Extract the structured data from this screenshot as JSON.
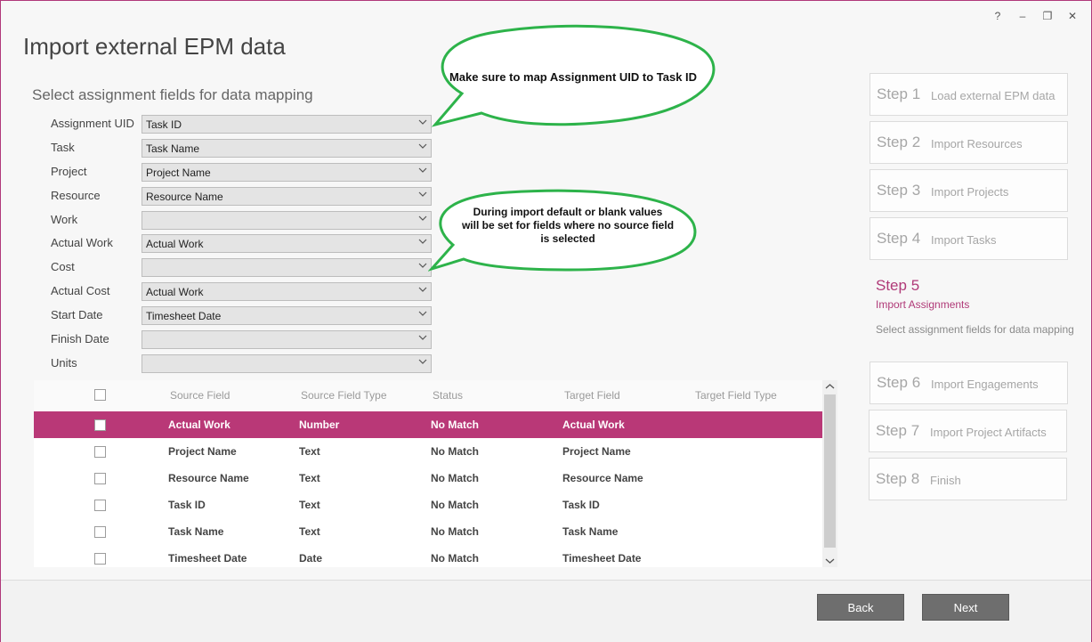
{
  "window": {
    "help_label": "?",
    "minimize_label": "–",
    "restore_label": "❐",
    "close_label": "✕"
  },
  "page": {
    "title": "Import external EPM data",
    "subtitle": "Select assignment fields for data mapping"
  },
  "mapping_fields": [
    {
      "label": "Assignment UID",
      "value": "Task ID"
    },
    {
      "label": "Task",
      "value": "Task Name"
    },
    {
      "label": "Project",
      "value": "Project Name"
    },
    {
      "label": "Resource",
      "value": "Resource Name"
    },
    {
      "label": "Work",
      "value": ""
    },
    {
      "label": "Actual Work",
      "value": "Actual Work"
    },
    {
      "label": "Cost",
      "value": ""
    },
    {
      "label": "Actual Cost",
      "value": "Actual Work"
    },
    {
      "label": "Start Date",
      "value": "Timesheet Date"
    },
    {
      "label": "Finish Date",
      "value": ""
    },
    {
      "label": "Units",
      "value": ""
    }
  ],
  "callouts": {
    "top": "Make sure to map Assignment UID to Task ID",
    "bottom_line1": "During import default or blank values",
    "bottom_line2": "will be set for fields where no source field",
    "bottom_line3": "is selected",
    "border_color": "#2db34a"
  },
  "grid": {
    "headers": {
      "source_field": "Source Field",
      "source_field_type": "Source Field Type",
      "status": "Status",
      "target_field": "Target Field",
      "target_field_type": "Target Field Type"
    },
    "rows": [
      {
        "source_field": "Actual Work",
        "source_field_type": "Number",
        "status": "No Match",
        "target_field": "Actual Work",
        "target_field_type": "",
        "selected": true
      },
      {
        "source_field": "Project Name",
        "source_field_type": "Text",
        "status": "No Match",
        "target_field": "Project Name",
        "target_field_type": "",
        "selected": false
      },
      {
        "source_field": "Resource Name",
        "source_field_type": "Text",
        "status": "No Match",
        "target_field": "Resource Name",
        "target_field_type": "",
        "selected": false
      },
      {
        "source_field": "Task ID",
        "source_field_type": "Text",
        "status": "No Match",
        "target_field": "Task ID",
        "target_field_type": "",
        "selected": false
      },
      {
        "source_field": "Task Name",
        "source_field_type": "Text",
        "status": "No Match",
        "target_field": "Task Name",
        "target_field_type": "",
        "selected": false
      },
      {
        "source_field": "Timesheet Date",
        "source_field_type": "Date",
        "status": "No Match",
        "target_field": "Timesheet Date",
        "target_field_type": "",
        "selected": false
      }
    ],
    "selected_color": "#b93877"
  },
  "steps": [
    {
      "num": "Step 1",
      "label": "Load external EPM data"
    },
    {
      "num": "Step 2",
      "label": "Import Resources"
    },
    {
      "num": "Step 3",
      "label": "Import Projects"
    },
    {
      "num": "Step 4",
      "label": "Import Tasks"
    },
    {
      "num": "Step 6",
      "label": "Import Engagements"
    },
    {
      "num": "Step 7",
      "label": "Import Project Artifacts"
    },
    {
      "num": "Step 8",
      "label": "Finish"
    }
  ],
  "active_step": {
    "num": "Step 5",
    "label": "Import Assignments",
    "description": "Select assignment fields for data mapping",
    "accent_color": "#b03a78"
  },
  "footer": {
    "back_label": "Back",
    "next_label": "Next"
  }
}
